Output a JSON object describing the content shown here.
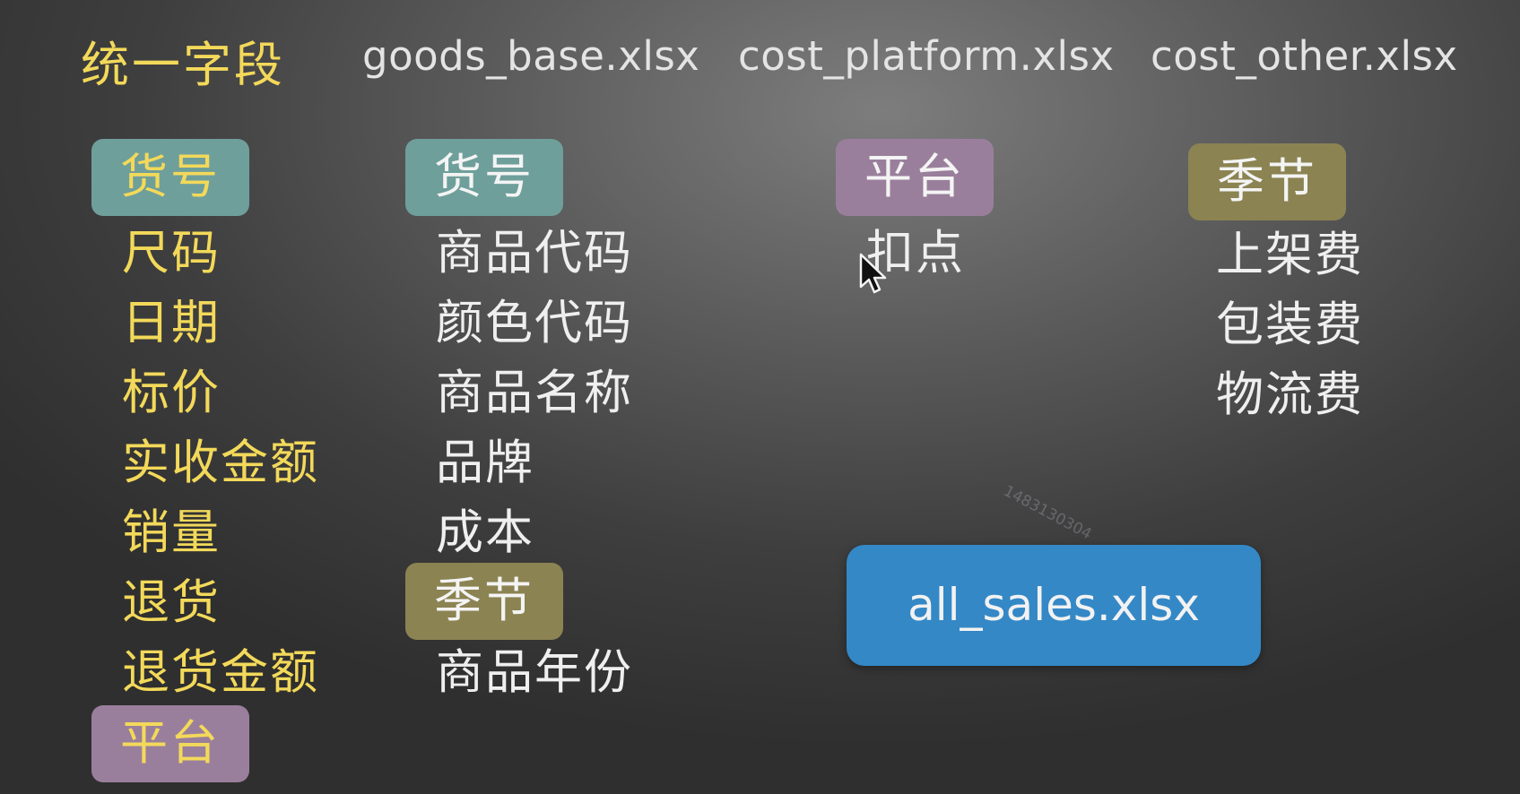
{
  "headers": {
    "unified": "统一字段",
    "goods_base": "goods_base.xlsx",
    "cost_platform": "cost_platform.xlsx",
    "cost_other": "cost_other.xlsx"
  },
  "unified_fields": {
    "key_tag": "货号",
    "items": [
      "尺码",
      "日期",
      "标价",
      "实收金额",
      "销量",
      "退货",
      "退货金额"
    ],
    "platform_tag": "平台"
  },
  "goods_base": {
    "key_tag": "货号",
    "items": [
      "商品代码",
      "颜色代码",
      "商品名称",
      "品牌",
      "成本"
    ],
    "season_tag": "季节",
    "after_season": [
      "商品年份"
    ]
  },
  "cost_platform": {
    "key_tag": "平台",
    "items": [
      "扣点"
    ]
  },
  "cost_other": {
    "key_tag": "季节",
    "items": [
      "上架费",
      "包装费",
      "物流费"
    ]
  },
  "output_file": "all_sales.xlsx",
  "watermark": "1483130304",
  "colors": {
    "teal_tag": "#6f9f9b",
    "purple_tag": "#9a7f9c",
    "olive_tag": "#8b8352",
    "output_box": "#3488c6",
    "yellow_text": "#f3d95a"
  }
}
